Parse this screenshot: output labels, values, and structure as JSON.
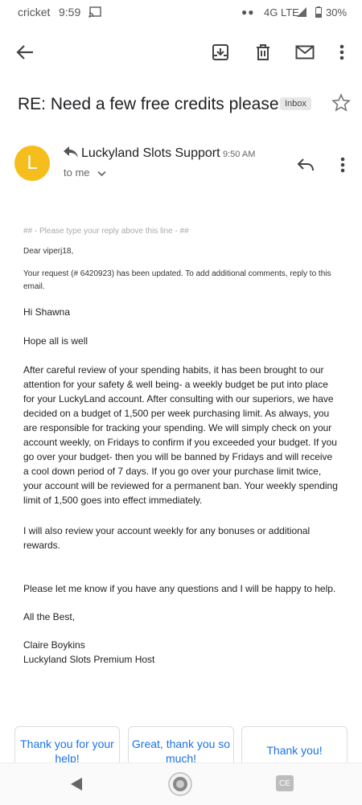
{
  "status": {
    "carrier": "cricket",
    "time": "9:59",
    "network": "4G LTE",
    "battery": "30%",
    "icons": [
      "cast-icon",
      "signal-icon",
      "battery-icon"
    ]
  },
  "toolbar": {
    "icons": [
      "back-arrow-icon",
      "archive-icon",
      "trash-icon",
      "mail-icon",
      "more-vert-icon"
    ]
  },
  "email": {
    "subject": "RE: Need a few free credits please",
    "label": "Inbox",
    "avatar_letter": "L",
    "avatar_color": "#f5be1c",
    "sender": "Luckyland Slots Support",
    "time": "9:50 AM",
    "to": "to me",
    "hint": "## - Please type your reply above this line - ##",
    "greeting": "Dear viperj18,",
    "request_notice": "Your request (# 6420923) has been updated. To add additional comments, reply to this email.",
    "hi": "Hi Shawna",
    "hope": "Hope all is well",
    "paragraph1": "After careful review of your spending habits, it has been brought to our attention for your safety & well being- a weekly budget be put into place for your LuckyLand account. After consulting with our superiors, we have decided on a budget of 1,500 per week purchasing limit. As always, you are responsible for tracking your spending. We will simply check on your account weekly, on Fridays to confirm if you exceeded your budget. If you go over your budget- then you will be banned by Fridays and will receive a cool down period of 7 days. If you go over your purchase limit twice, your account will be reviewed for a permanent ban. Your weekly spending limit of  1,500 goes into effect immediately.",
    "paragraph2": "I will also review your account weekly for any bonuses or additional rewards.",
    "paragraph3": "Please let me know if you have any questions and I will be happy to help.",
    "closing": "All the Best,",
    "signature_name": "Claire Boykins",
    "signature_title": "Luckyland Slots Premium Host"
  },
  "smart_replies": [
    "Thank you for your help!",
    "Great, thank you so much!",
    "Thank you!"
  ],
  "navbar": {
    "icons": [
      "back-triangle-icon",
      "home-circle-icon",
      "recents-icon"
    ],
    "recents_text": "CE"
  },
  "colors": {
    "accent": "#1a73e8",
    "avatar": "#f5be1c"
  }
}
